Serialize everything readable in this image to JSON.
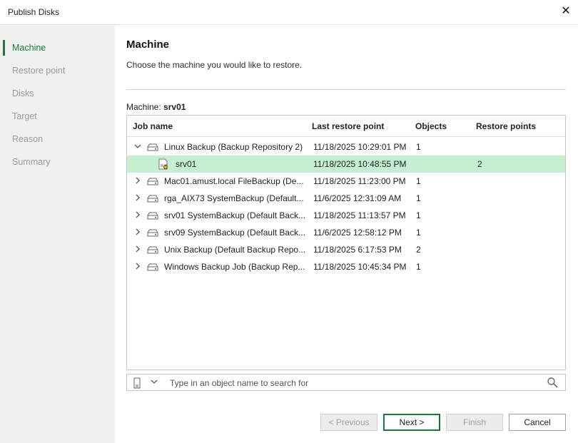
{
  "window": {
    "title": "Publish Disks",
    "close_glyph": "✕"
  },
  "sidebar": {
    "steps": [
      {
        "label": "Machine",
        "active": true
      },
      {
        "label": "Restore point"
      },
      {
        "label": "Disks"
      },
      {
        "label": "Target"
      },
      {
        "label": "Reason"
      },
      {
        "label": "Summary"
      }
    ]
  },
  "page": {
    "heading": "Machine",
    "subtitle": "Choose the machine you would like to restore.",
    "machine_label": "Machine:",
    "machine_value": "srv01"
  },
  "table": {
    "columns": [
      "Job name",
      "Last restore point",
      "Objects",
      "Restore points"
    ],
    "rows": [
      {
        "name": "Linux Backup (Backup Repository 2)",
        "last": "11/18/2025 10:29:01 PM",
        "objects": "1",
        "restore_points": "",
        "expanded": true
      },
      {
        "name": "srv01",
        "last": "11/18/2025 10:48:55 PM",
        "objects": "",
        "restore_points": "2",
        "child": true,
        "selected": true
      },
      {
        "name": "Mac01.amust.local FileBackup (De...",
        "last": "11/18/2025 11:23:00 PM",
        "objects": "1",
        "restore_points": ""
      },
      {
        "name": "rga_AIX73 SystemBackup (Default...",
        "last": "11/6/2025 12:31:09 AM",
        "objects": "1",
        "restore_points": ""
      },
      {
        "name": "srv01 SystemBackup (Default Back...",
        "last": "11/18/2025 11:13:57 PM",
        "objects": "1",
        "restore_points": ""
      },
      {
        "name": "srv09 SystemBackup (Default Back...",
        "last": "11/6/2025 12:58:12 PM",
        "objects": "1",
        "restore_points": ""
      },
      {
        "name": "Unix Backup (Default Backup Repo...",
        "last": "11/18/2025 6:17:53 PM",
        "objects": "2",
        "restore_points": ""
      },
      {
        "name": "Windows Backup Job (Backup Rep...",
        "last": "11/18/2025 10:45:34 PM",
        "objects": "1",
        "restore_points": ""
      }
    ]
  },
  "search": {
    "placeholder": "Type in an object name to search for"
  },
  "buttons": {
    "previous": "< Previous",
    "next": "Next >",
    "finish": "Finish",
    "cancel": "Cancel"
  },
  "colors": {
    "accent": "#1a7a3c",
    "selected_row": "#c5efd0",
    "sidebar_bg": "#f0f0f0"
  },
  "icons": {
    "expanded": "chevron-down-icon",
    "collapsed": "chevron-right-icon",
    "job": "backup-job-icon",
    "machine": "linux-machine-icon",
    "search": "search-icon"
  }
}
